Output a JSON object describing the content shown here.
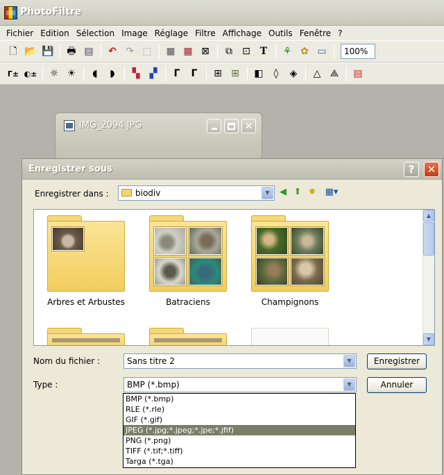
{
  "app": {
    "title": "PhotoFiltre"
  },
  "menu": [
    "Fichier",
    "Edition",
    "Sélection",
    "Image",
    "Réglage",
    "Filtre",
    "Affichage",
    "Outils",
    "Fenêtre",
    "?"
  ],
  "toolbar": {
    "zoom_value": "100%"
  },
  "image_window": {
    "title": "IMG_2094.JPG"
  },
  "dialog": {
    "title": "Enregistrer sous",
    "help": "?",
    "close": "✕",
    "save_in_label": "Enregistrer dans :",
    "save_in_value": "biodiv",
    "folders": [
      {
        "name": "Arbres et Arbustes"
      },
      {
        "name": "Batraciens"
      },
      {
        "name": "Champignons"
      }
    ],
    "filename_label": "Nom du fichier :",
    "filename_value": "Sans titre 2",
    "type_label": "Type :",
    "type_value": "BMP (*.bmp)",
    "save_button": "Enregistrer",
    "cancel_button": "Annuler",
    "type_options": [
      "BMP (*.bmp)",
      "RLE (*.rle)",
      "GIF (*.gif)",
      "JPEG (*.jpg;*.jpeg;*.jpe;*.jfif)",
      "PNG (*.png)",
      "TIFF (*.tif;*.tiff)",
      "Targa (*.tga)"
    ],
    "selected_option": "JPEG (*.jpg;*.jpeg;*.jpe;*.jfif)"
  },
  "colors": {
    "selection": "#7a7e68",
    "folder": "#f2ce5e",
    "close_red": "#c83c14"
  }
}
